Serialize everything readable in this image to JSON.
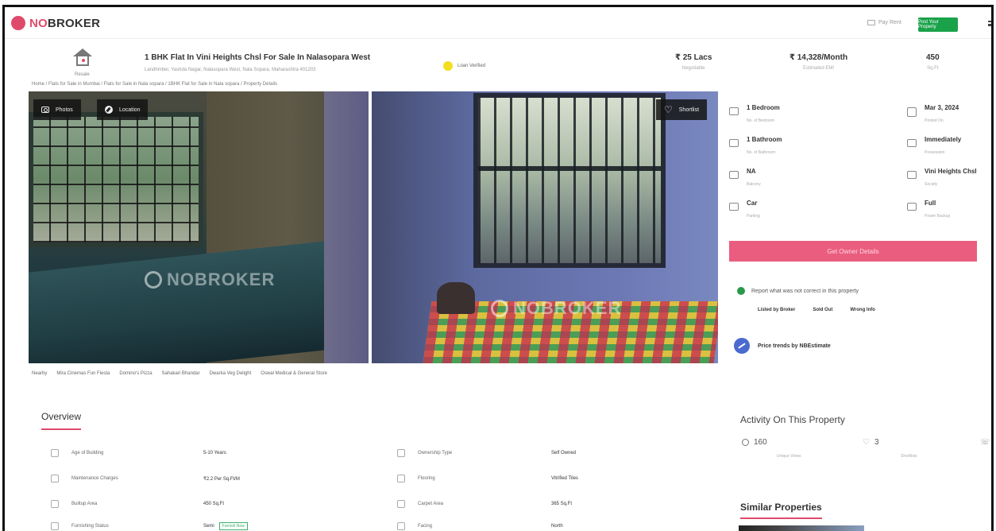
{
  "header": {
    "logo_text_accent": "NO",
    "logo_text": "BROKER",
    "pay_rent": "Pay Rent",
    "post_property": "Post Your Property"
  },
  "property": {
    "type_label": "Resale",
    "title": "1 BHK Flat In Vini Heights Chsl For Sale In Nalasopara West",
    "address": "Landhmber, Yashda Nagar, Nalasopara West, Nala Sopara, Maharashtra 401203",
    "verified": "Loan Verified",
    "price": "₹ 25 Lacs",
    "price_sub": "Negotiable",
    "emi": "₹ 14,328/Month",
    "emi_sub": "Estimated EMI",
    "area": "450",
    "area_sub": "Sq.Ft"
  },
  "breadcrumb": "Home / Flats for Sale in Mumbai / Flats for Sale in Nala sopara / 1BHK Flat for Sale in Nala sopara / Property Details",
  "gallery": {
    "photos_label": "Photos",
    "location_label": "Location",
    "shortlist_label": "Shortlist",
    "watermark": "NOBROKER"
  },
  "nearby": [
    "Nearby",
    "Mira Cinemas Fun Fiesta",
    "Domino's Pizza",
    "Sahakari Bhandar",
    "Dwarka Veg Delight",
    "Oswal Medical & General Store"
  ],
  "details": [
    {
      "value": "1 Bedroom",
      "sub": "No. of Bedroom",
      "icon": "bed-icon"
    },
    {
      "value": "Mar 3, 2024",
      "sub": "Posted On",
      "icon": "calendar-icon"
    },
    {
      "value": "1 Bathroom",
      "sub": "No. of Bathroom",
      "icon": "bath-icon"
    },
    {
      "value": "Immediately",
      "sub": "Possession",
      "icon": "key-icon"
    },
    {
      "value": "NA",
      "sub": "Balcony",
      "icon": "balcony-icon"
    },
    {
      "value": "Vini Heights Chsl",
      "sub": "Society",
      "icon": "building-icon"
    },
    {
      "value": "Car",
      "sub": "Parking",
      "icon": "car-icon"
    },
    {
      "value": "Full",
      "sub": "Power Backup",
      "icon": "power-icon"
    }
  ],
  "owner_button": "Get Owner Details",
  "report": {
    "text": "Report what was not correct in this property",
    "options": [
      "Listed by Broker",
      "Sold Out",
      "Wrong Info"
    ]
  },
  "price_trend": "Price trends by NBEstimate",
  "overview": {
    "title": "Overview",
    "rows": [
      {
        "label": "Age of Building",
        "value": "5-10 Years",
        "icon": "building-age-icon"
      },
      {
        "label": "Ownership Type",
        "value": "Self Owned",
        "icon": "ownership-icon"
      },
      {
        "label": "Maintenance Charges",
        "value": "₹2.2 Per Sq.Ft/M",
        "icon": "maintenance-icon"
      },
      {
        "label": "Flooring",
        "value": "Vitrified Tiles",
        "icon": "flooring-icon"
      },
      {
        "label": "Builtup Area",
        "value": "450 Sq.Ft",
        "icon": "builtup-icon"
      },
      {
        "label": "Carpet Area",
        "value": "365 Sq.Ft",
        "icon": "carpet-icon"
      },
      {
        "label": "Furnishing Status",
        "value": "Semi",
        "badge": "Furnish Now",
        "icon": "furnishing-icon"
      },
      {
        "label": "Facing",
        "value": "North",
        "icon": "facing-icon"
      }
    ]
  },
  "activity": {
    "title": "Activity On This Property",
    "views": "160",
    "views_sub": "Unique Views",
    "shortlists": "3",
    "shortlists_sub": "Shortlists",
    "contacted_icon": "chat-icon"
  },
  "similar": {
    "title": "Similar Properties"
  }
}
